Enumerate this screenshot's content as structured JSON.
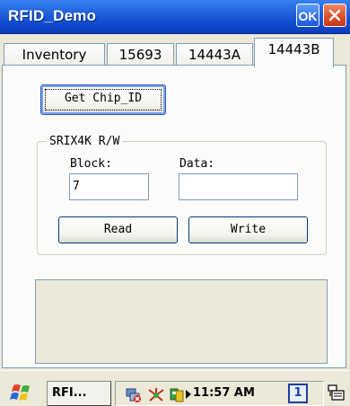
{
  "window": {
    "title": "RFID_Demo",
    "ok_label": "OK"
  },
  "tabs": [
    {
      "label": "Inventory",
      "active": false
    },
    {
      "label": "15693",
      "active": false
    },
    {
      "label": "14443A",
      "active": false
    },
    {
      "label": "14443B",
      "active": true
    }
  ],
  "panel": {
    "get_chip_button": "Get Chip_ID",
    "group_title": "SRIX4K R/W",
    "block_label": "Block:",
    "data_label": "Data:",
    "block_value": "7",
    "data_value": "",
    "read_button": "Read",
    "write_button": "Write",
    "output_text": ""
  },
  "taskbar": {
    "task_label": "RFI...",
    "clock": "11:57 AM",
    "input_indicator": "1"
  },
  "colors": {
    "titlebar": "#0b46c8",
    "close_button": "#e0502c",
    "border": "#7f9db9",
    "background": "#ece9d8"
  },
  "icons": [
    "windows-flag-icon",
    "network-disconnected-icon",
    "wireless-icon",
    "sync-icon",
    "arrow-right-icon",
    "sip-keyboard-icon"
  ]
}
